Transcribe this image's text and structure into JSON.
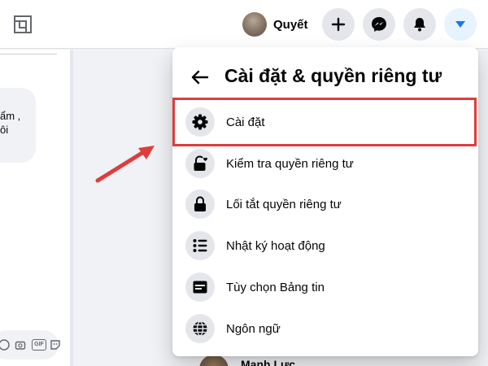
{
  "header": {
    "profile_name": "Quyết"
  },
  "left": {
    "bubble_lines": [
      "ẩm ,",
      "ôi"
    ],
    "composer_gif": "GIF"
  },
  "peek": {
    "name": "Mạnh Lực"
  },
  "dropdown": {
    "title": "Cài đặt & quyền riêng tư",
    "items": [
      {
        "label": "Cài đặt",
        "icon": "gear-icon"
      },
      {
        "label": "Kiểm tra quyền riêng tư",
        "icon": "lock-heart-icon"
      },
      {
        "label": "Lối tắt quyền riêng tư",
        "icon": "lock-icon"
      },
      {
        "label": "Nhật ký hoạt động",
        "icon": "list-icon"
      },
      {
        "label": "Tùy chọn Bảng tin",
        "icon": "feed-icon"
      },
      {
        "label": "Ngôn ngữ",
        "icon": "globe-icon"
      }
    ]
  },
  "colors": {
    "highlight": "#e03c3c",
    "accent": "#1877f2",
    "icon_bg": "#e4e6eb"
  }
}
